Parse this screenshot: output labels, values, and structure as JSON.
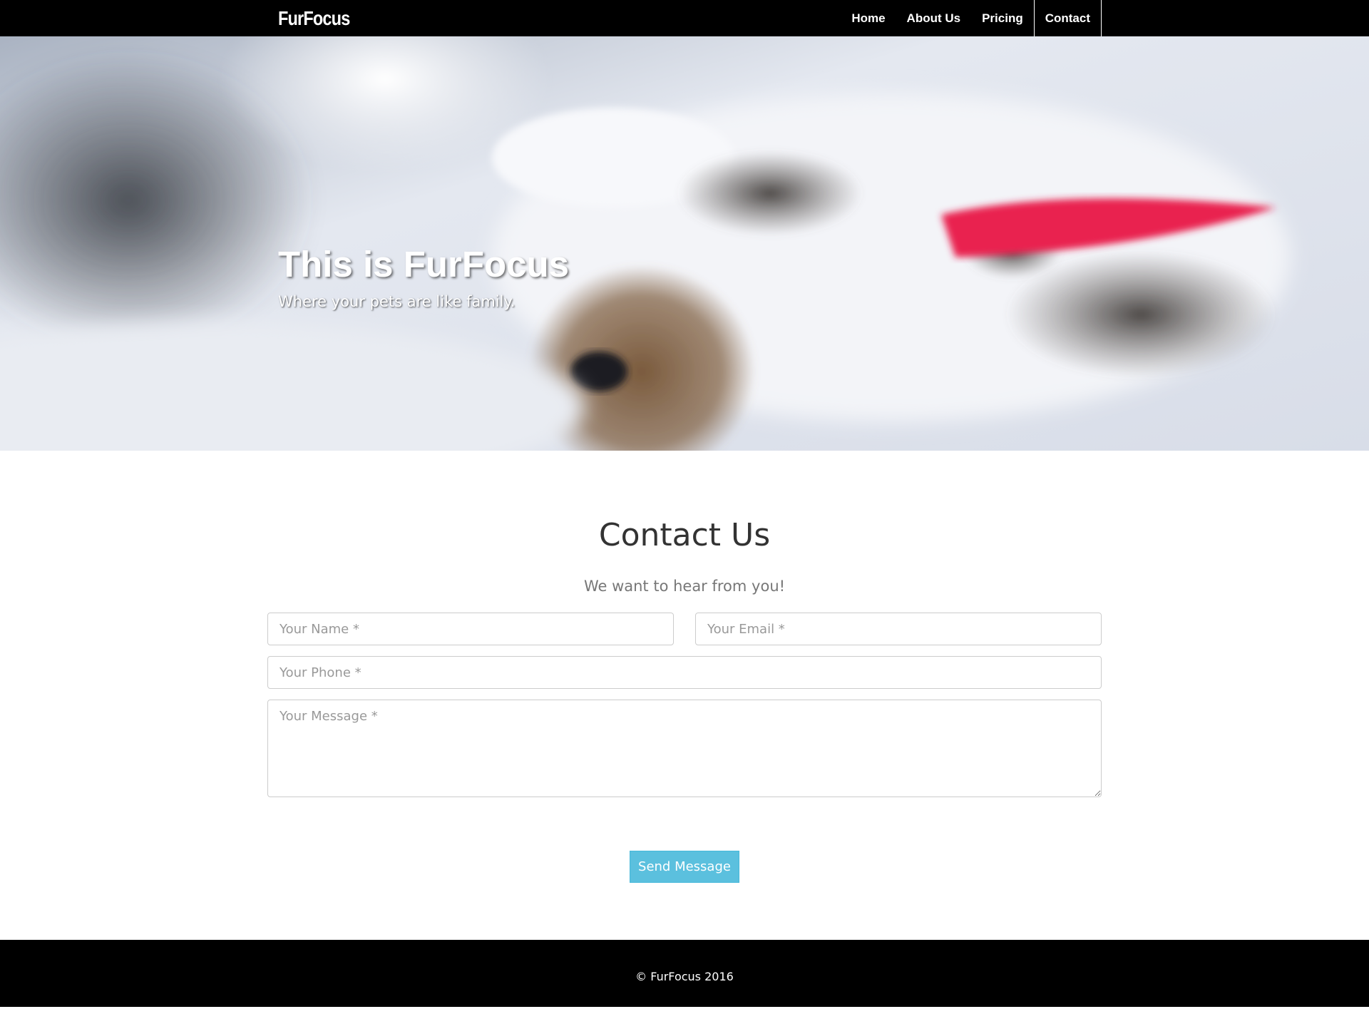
{
  "navbar": {
    "brand": "FurFocus",
    "items": [
      {
        "label": "Home",
        "active": false
      },
      {
        "label": "About Us",
        "active": false
      },
      {
        "label": "Pricing",
        "active": false
      },
      {
        "label": "Contact",
        "active": true
      }
    ]
  },
  "hero": {
    "title": "This is FurFocus",
    "subtitle": "Where your pets are like family."
  },
  "contact": {
    "title": "Contact Us",
    "subtitle": "We want to hear from you!",
    "fields": {
      "name_placeholder": "Your Name *",
      "email_placeholder": "Your Email *",
      "phone_placeholder": "Your Phone *",
      "message_placeholder": "Your Message *"
    },
    "send_label": "Send Message"
  },
  "footer": {
    "copyright": "© FurFocus 2016"
  },
  "colors": {
    "navbar_bg": "#000000",
    "button_bg": "#5bc0de",
    "footer_bg": "#000000"
  }
}
